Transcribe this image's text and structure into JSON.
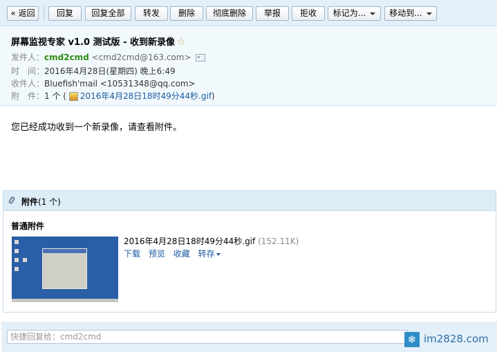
{
  "toolbar": {
    "back": "« 返回",
    "reply": "回复",
    "reply_all": "回复全部",
    "forward": "转发",
    "delete": "删除",
    "delete_permanent": "彻底删除",
    "report": "举报",
    "reject": "拒收",
    "mark_as": "标记为...",
    "move_to": "移动到..."
  },
  "email": {
    "subject": "屏幕监视专家 v1.0 测试版 - 收到新录像",
    "from_label": "发件人：",
    "from_name": "cmd2cmd",
    "from_addr": "<cmd2cmd@163.com>",
    "time_label": "时　间：",
    "time": "2016年4月28日(星期四) 晚上6:49",
    "to_label": "收件人：",
    "to": "Bluefish'mail <10531348@qq.com>",
    "att_label": "附　件：",
    "att_count": "1 个 (",
    "att_file": "2016年4月28日18时49分44秒.gif",
    "att_close": ")",
    "body": "您已经成功收到一个新录像，请查看附件。"
  },
  "attachments": {
    "title": "附件",
    "count": "(1 个)",
    "group": "普通附件",
    "file_name": "2016年4月28日18时49分44秒.gif",
    "file_size": "(152.11K)",
    "download": "下载",
    "preview": "预览",
    "favorite": "收藏",
    "save_to": "转存"
  },
  "quick_reply": {
    "placeholder": "快捷回复给：cmd2cmd"
  },
  "watermark": {
    "text": "im2828.com"
  },
  "colors": {
    "toolbar_bg": "#e3f0fa",
    "header_bg": "#f2f9fd",
    "sender_green": "#2f8d14",
    "link_blue": "#1a5aa0"
  }
}
